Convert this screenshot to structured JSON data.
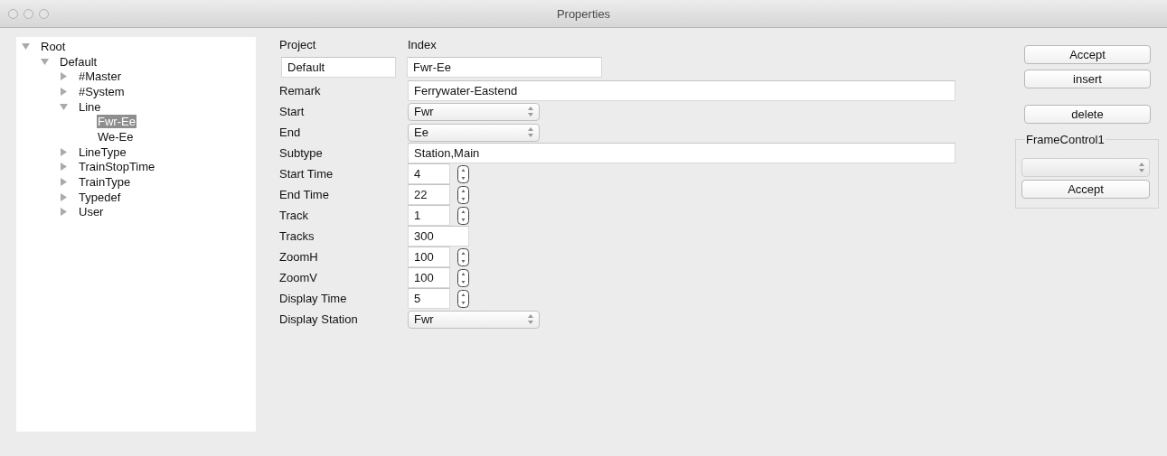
{
  "window": {
    "title": "Properties"
  },
  "tree": [
    {
      "label": "Root",
      "expanded": true,
      "selected": false,
      "children": [
        {
          "label": "Default",
          "expanded": true,
          "selected": false,
          "children": [
            {
              "label": "#Master",
              "expanded": false,
              "selected": false
            },
            {
              "label": "#System",
              "expanded": false,
              "selected": false
            },
            {
              "label": "Line",
              "expanded": true,
              "selected": false,
              "children": [
                {
                  "label": "Fwr-Ee",
                  "selected": true
                },
                {
                  "label": "We-Ee",
                  "selected": false
                }
              ]
            },
            {
              "label": "LineType",
              "expanded": false,
              "selected": false
            },
            {
              "label": "TrainStopTime",
              "expanded": false,
              "selected": false
            },
            {
              "label": "TrainType",
              "expanded": false,
              "selected": false
            },
            {
              "label": "Typedef",
              "expanded": false,
              "selected": false
            },
            {
              "label": "User",
              "expanded": false,
              "selected": false
            }
          ]
        }
      ]
    }
  ],
  "header": {
    "project_label": "Project",
    "index_label": "Index",
    "project_value": "Default",
    "index_value": "Fwr-Ee"
  },
  "fields": [
    {
      "label": "Remark",
      "kind": "text",
      "value": "Ferrywater-Eastend"
    },
    {
      "label": "Start",
      "kind": "select",
      "value": "Fwr"
    },
    {
      "label": "End",
      "kind": "select",
      "value": "Ee"
    },
    {
      "label": "Subtype",
      "kind": "text",
      "value": "Station,Main"
    },
    {
      "label": "Start Time",
      "kind": "spin",
      "value": "4"
    },
    {
      "label": "End Time",
      "kind": "spin",
      "value": "22"
    },
    {
      "label": "Track",
      "kind": "spin",
      "value": "1"
    },
    {
      "label": "Tracks",
      "kind": "short",
      "value": "300"
    },
    {
      "label": "ZoomH",
      "kind": "spin",
      "value": "100"
    },
    {
      "label": "ZoomV",
      "kind": "spin",
      "value": "100"
    },
    {
      "label": "Display Time",
      "kind": "spin",
      "value": "5"
    },
    {
      "label": "Display Station",
      "kind": "select",
      "value": "Fwr"
    }
  ],
  "buttons": [
    "Accept",
    "insert",
    "delete"
  ],
  "frame": {
    "title": "FrameControl1",
    "button": "Accept"
  }
}
